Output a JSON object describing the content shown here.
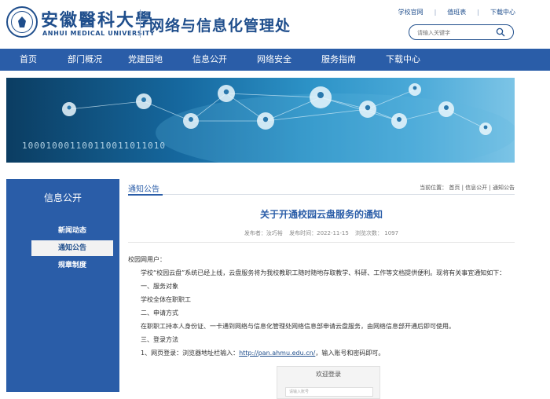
{
  "header": {
    "logo_cn": "安徽醫科大學",
    "logo_en": "ANHUI MEDICAL UNIVERSITY",
    "dept_title": "网络与信息化管理处",
    "top_links": [
      "学校官网",
      "值班表",
      "下载中心"
    ],
    "search_placeholder": "请输入关键字"
  },
  "nav": {
    "items": [
      "首页",
      "部门概况",
      "党建园地",
      "信息公开",
      "网络安全",
      "服务指南",
      "下载中心"
    ]
  },
  "banner": {
    "bits_text": "100010001100110011011010"
  },
  "sidebar": {
    "title": "信息公开",
    "items": [
      "新闻动态",
      "通知公告",
      "规章制度"
    ],
    "active_index": 1
  },
  "content": {
    "section_title": "通知公告",
    "breadcrumb": {
      "prefix": "当前位置：",
      "items": [
        "首页",
        "信息公开",
        "通知公告"
      ]
    },
    "article": {
      "title": "关于开通校园云盘服务的通知",
      "author": "发布者：汝巧裕",
      "date": "发布时间：2022-11-15",
      "views": "浏览次数：  1097",
      "paragraphs": [
        "校园网用户：",
        "学校“校园云盘”系统已经上线，云盘服务将为我校教职工随时随地存取教学、科研、工作等文档提供便利。现将有关事宜通知如下：",
        "一、服务对象",
        "学校全体在职职工",
        "二、申请方式",
        "在职职工持本人身份证、一卡通到网络与信息化管理处网络信息部申请云盘服务，由网络信息部开通后即可使用。",
        "三、登录方法"
      ],
      "login_line_prefix": "1、网页登录：浏览器地址栏输入：",
      "login_url": "http://pan.ahmu.edu.cn/",
      "login_line_suffix": "，输入账号和密码即可。"
    },
    "login_preview": {
      "title": "欢迎登录",
      "input_placeholder": "请输入账号"
    }
  },
  "colors": {
    "primary": "#2a5da8",
    "brand_text": "#1f4e8c"
  }
}
